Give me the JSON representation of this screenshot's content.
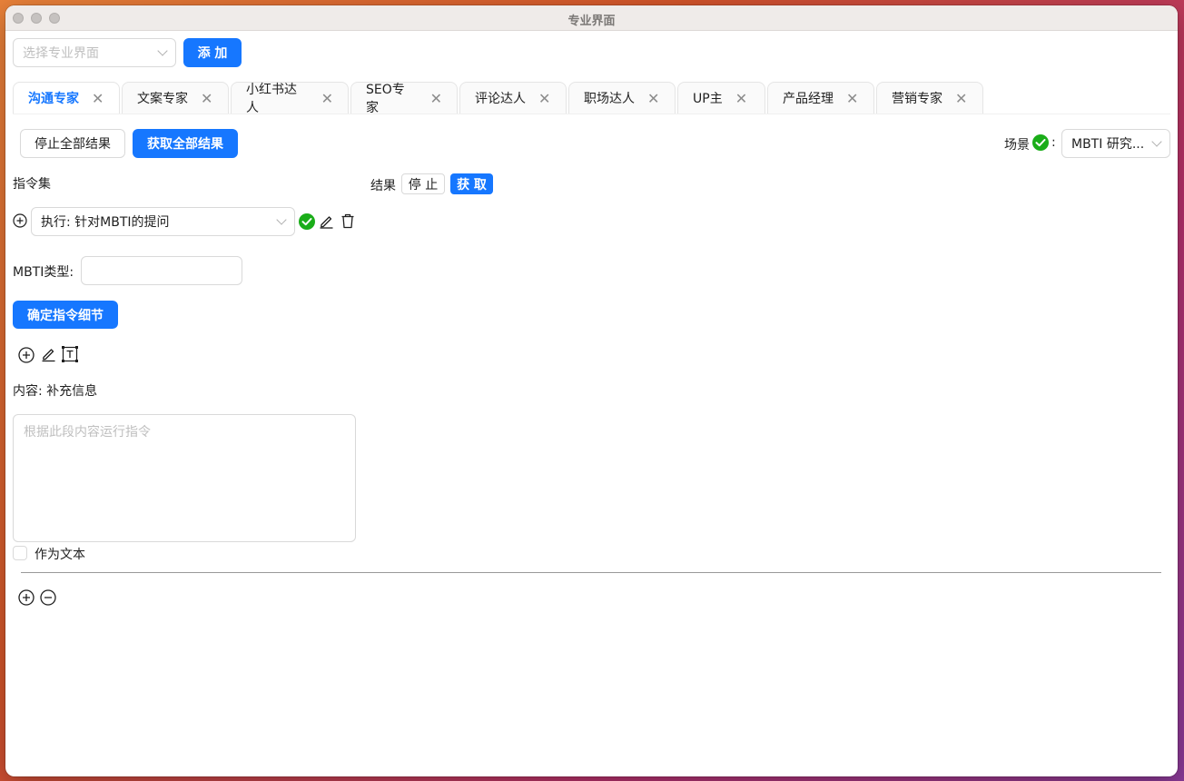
{
  "window": {
    "title": "专业界面"
  },
  "top": {
    "select_placeholder": "选择专业界面",
    "add_label": "添 加"
  },
  "tabs": [
    {
      "label": "沟通专家",
      "active": true
    },
    {
      "label": "文案专家"
    },
    {
      "label": "小红书达人"
    },
    {
      "label": "SEO专家"
    },
    {
      "label": "评论达人"
    },
    {
      "label": "职场达人"
    },
    {
      "label": "UP主"
    },
    {
      "label": "产品经理"
    },
    {
      "label": "营销专家"
    }
  ],
  "toolbar": {
    "stop_all": "停止全部结果",
    "get_all": "获取全部结果",
    "scene_label": "场景",
    "scene_colon": ":",
    "scene_value": "MBTI 研究..."
  },
  "commands": {
    "header": "指令集",
    "selected": "执行: 针对MBTI的提问",
    "mbti_label": "MBTI类型:",
    "mbti_value": "",
    "confirm_label": "确定指令细节",
    "content_label": "内容: 补充信息",
    "content_placeholder": "根据此段内容运行指令",
    "as_text_label": "作为文本"
  },
  "results": {
    "header": "结果",
    "stop": "停 止",
    "get": "获 取"
  },
  "colors": {
    "primary": "#1677ff",
    "success": "#1aad19"
  }
}
